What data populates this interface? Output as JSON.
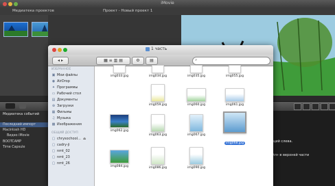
{
  "imovie": {
    "window_title": "iMovie",
    "project_library": "Медиатека проектов",
    "project_name": "Проект - Новый проект 1",
    "event_library_header": "Медиатека событий",
    "events": [
      "Последний импорт",
      "Macintosh HD",
      "Видео iMovie",
      "BOOTCAMP",
      "Time Capsule"
    ],
    "hint_lines": [
      "ций слева.",
      "меню «Файл» в верхней части"
    ]
  },
  "finder": {
    "title": "1 часть",
    "sidebar": {
      "favorites_header": "ИЗБРАННОЕ",
      "favorites": [
        {
          "label": "Мои файлы",
          "icon": "files-icon"
        },
        {
          "label": "AirDrop",
          "icon": "airdrop-icon"
        },
        {
          "label": "Программы",
          "icon": "applications-icon"
        },
        {
          "label": "Рабочий стол",
          "icon": "desktop-icon"
        },
        {
          "label": "Документы",
          "icon": "documents-icon"
        },
        {
          "label": "Загрузки",
          "icon": "downloads-icon"
        },
        {
          "label": "Фильмы",
          "icon": "movies-icon"
        },
        {
          "label": "Музыка",
          "icon": "music-icon"
        },
        {
          "label": "Изображения",
          "icon": "pictures-icon"
        }
      ],
      "shared_header": "ОБЩИЙ ДОСТУП",
      "shared": [
        "chrysochool...",
        "cadry-ji",
        "nmt_02",
        "nmt_23",
        "nmt_26"
      ]
    },
    "files": [
      {
        "name": "img033.jpg"
      },
      {
        "name": "img034.jpg"
      },
      {
        "name": "img035.jpg"
      },
      {
        "name": "img055.jpg"
      },
      {
        "name": "img059.jpg"
      },
      {
        "name": "img060.jpg"
      },
      {
        "name": "img061.jpg"
      },
      {
        "name": "img062.jpg"
      },
      {
        "name": "img063.jpg"
      },
      {
        "name": "img067.jpg"
      },
      {
        "name": "img068.jpg",
        "selected": true
      },
      {
        "name": "img084.jpg"
      },
      {
        "name": "img086.jpg"
      },
      {
        "name": "img090.jpg"
      }
    ]
  }
}
